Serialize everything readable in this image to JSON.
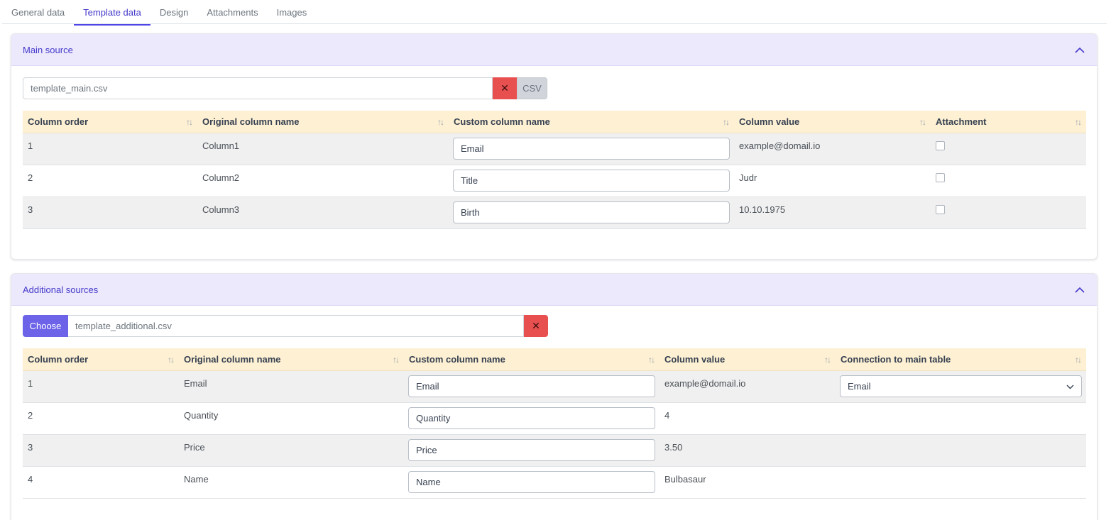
{
  "tabs": [
    {
      "label": "General data",
      "active": false
    },
    {
      "label": "Template data",
      "active": true
    },
    {
      "label": "Design",
      "active": false
    },
    {
      "label": "Attachments",
      "active": false
    },
    {
      "label": "Images",
      "active": false
    }
  ],
  "main_source": {
    "title": "Main source",
    "file_name": "template_main.csv",
    "clear_icon": "✕",
    "type_label": "CSV",
    "columns": [
      "Column order",
      "Original column name",
      "Custom column name",
      "Column value",
      "Attachment"
    ],
    "rows": [
      {
        "order": "1",
        "original": "Column1",
        "custom": "Email",
        "value": "example@domail.io",
        "attachment": false
      },
      {
        "order": "2",
        "original": "Column2",
        "custom": "Title",
        "value": "Judr",
        "attachment": false
      },
      {
        "order": "3",
        "original": "Column3",
        "custom": "Birth",
        "value": "10.10.1975",
        "attachment": false
      }
    ]
  },
  "additional_sources": {
    "title": "Additional sources",
    "choose_label": "Choose",
    "file_name": "template_additional.csv",
    "clear_icon": "✕",
    "columns": [
      "Column order",
      "Original column name",
      "Custom column name",
      "Column value",
      "Connection to main table"
    ],
    "rows": [
      {
        "order": "1",
        "original": "Email",
        "custom": "Email",
        "value": "example@domail.io",
        "connection": "Email"
      },
      {
        "order": "2",
        "original": "Quantity",
        "custom": "Quantity",
        "value": "4",
        "connection": ""
      },
      {
        "order": "3",
        "original": "Price",
        "custom": "Price",
        "value": "3.50",
        "connection": ""
      },
      {
        "order": "4",
        "original": "Name",
        "custom": "Name",
        "value": "Bulbasaur",
        "connection": ""
      }
    ]
  },
  "sort_icon": "↑↓",
  "colors": {
    "accent": "#4f46e5",
    "header_bg": "#ece9fc",
    "table_header_bg": "#fdf0d3",
    "danger": "#e85050"
  }
}
